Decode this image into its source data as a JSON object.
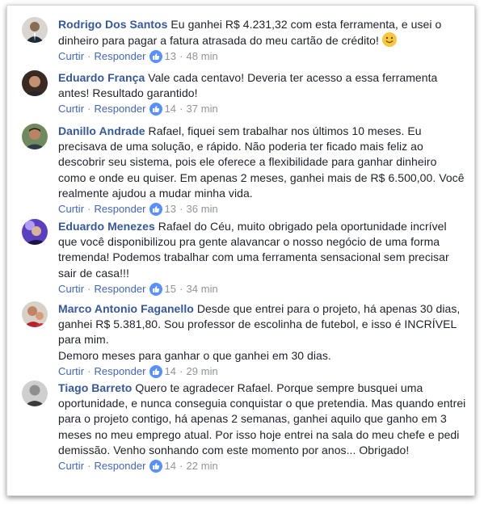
{
  "comments": [
    {
      "author": "Rodrigo Dos Santos",
      "text": "Eu ganhei R$ 4.231,32 com esta ferramenta, e usei o dinheiro para pagar a fatura atrasada do meu cartão de crédito!",
      "emoji": "smiley-emoji",
      "like_label": "Curtir",
      "reply_label": "Responder",
      "likes": "13",
      "time": "48 min"
    },
    {
      "author": "Eduardo França",
      "text": "Vale cada centavo! Deveria ter acesso a essa ferramenta antes! Resultado garantido!",
      "like_label": "Curtir",
      "reply_label": "Responder",
      "likes": "14",
      "time": "37 min"
    },
    {
      "author": "Danillo Andrade",
      "text": "Rafael, fiquei sem trabalhar nos últimos 10 meses. Eu precisava de uma solução, e rápido. Não poderia ter ficado mais feliz ao descobrir seu sistema, pois ele oferece a flexibilidade para ganhar dinheiro como e onde eu quiser. Em apenas 2 meses, ganhei mais de R$ 6.500,00. Você realmente ajudou a mudar minha vida.",
      "like_label": "Curtir",
      "reply_label": "Responder",
      "likes": "13",
      "time": "36 min"
    },
    {
      "author": "Eduardo Menezes",
      "text": "Rafael do Céu, muito obrigado pela oportunidade incrível que você disponibilizou pra gente alavancar o nosso negócio de uma forma tremenda! Podemos trabalhar com uma ferramenta sensacional sem precisar sair de casa!!!",
      "like_label": "Curtir",
      "reply_label": "Responder",
      "likes": "15",
      "time": "34 min"
    },
    {
      "author": "Marco Antonio Faganello",
      "text": "Desde que entrei para o projeto, há apenas 30 dias, ganhei R$ 5.381,80. Sou professor de escolinha de futebol, e isso é INCRÍVEL para mim.",
      "text2": "Demoro meses para ganhar o que ganhei em 30 dias.",
      "like_label": "Curtir",
      "reply_label": "Responder",
      "likes": "14",
      "time": "29 min"
    },
    {
      "author": "Tiago Barreto",
      "text": "Quero te agradecer Rafael. Porque sempre busquei uma oportunidade, e nunca conseguia conquistar o que pretendia. Mas quando entrei para o projeto contigo, há apenas 2 semanas, ganhei aquilo que ganho em 3 meses no meu emprego atual. Por isso hoje entrei na sala do meu chefe e pedi demissão. Venho sonhando com este momento por anos... Obrigado!",
      "like_label": "Curtir",
      "reply_label": "Responder",
      "likes": "14",
      "time": "22 min"
    }
  ],
  "colors": {
    "author": "#365899",
    "link": "#4267b2",
    "meta": "#90949c",
    "text": "#1d2129",
    "like_badge": "#5890ff"
  },
  "icons": {
    "like": "thumbs-up-icon",
    "emoji": "smiley-emoji"
  }
}
